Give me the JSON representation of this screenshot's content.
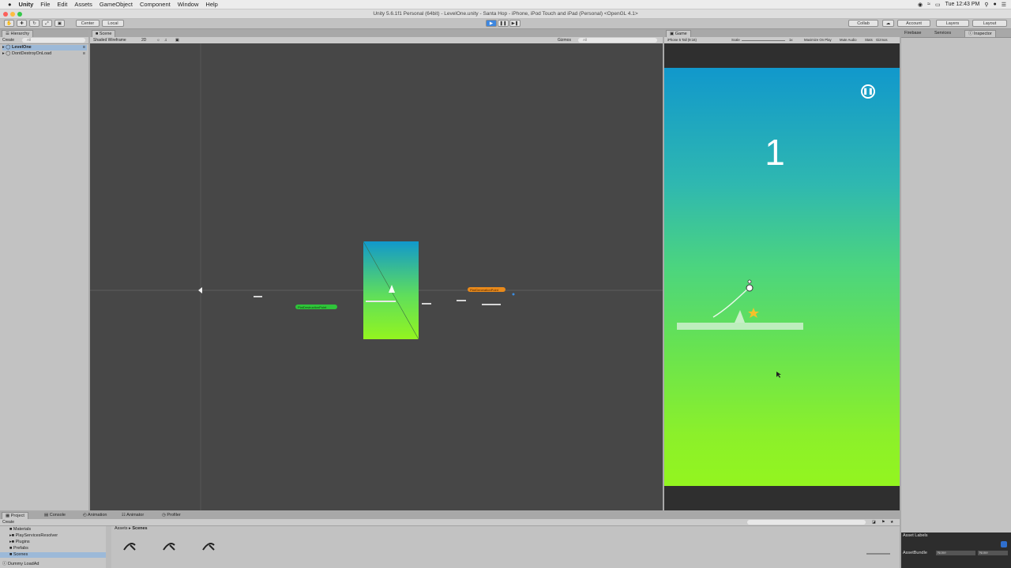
{
  "menubar": {
    "apple": "",
    "items": [
      "Unity",
      "File",
      "Edit",
      "Assets",
      "GameObject",
      "Component",
      "Window",
      "Help"
    ],
    "clock": "Tue 12:43 PM"
  },
  "window": {
    "title": "Unity 5.6.1f1 Personal (64bit) - LevelOne.unity - Santa Hop - iPhone, iPod Touch and iPad (Personal) <OpenGL 4.1>"
  },
  "toolbar": {
    "pivot_center": "Center",
    "pivot_local": "Local",
    "collab": "Collab",
    "account": "Account",
    "layers": "Layers",
    "layout": "Layout"
  },
  "hierarchy": {
    "tab": "Hierarchy",
    "create": "Create",
    "search_placeholder": "All",
    "items": [
      "LevelOne",
      "DontDestroyOnLoad"
    ]
  },
  "scene": {
    "tab": "Scene",
    "shading": "Shaded Wireframe",
    "mode_2d": "2D",
    "gizmos": "Gizmos",
    "search_placeholder": "All",
    "label_green": "PlatDestructionPoint",
    "label_orange": "PlatGenerationPoint"
  },
  "game": {
    "tab": "Game",
    "aspect": "iPhone 5 Tall (9:16)",
    "scale_label": "Scale",
    "scale_value": "1x",
    "maximize": "Maximize On Play",
    "mute": "Mute Audio",
    "stats": "Stats",
    "gizmos": "Gizmos",
    "score": "1",
    "pause_icon": "pause-circle-icon",
    "colors": {
      "top": "#1198cc",
      "bottom": "#93f51f"
    }
  },
  "right_tabs": [
    "Firebase",
    "Services",
    "Inspector"
  ],
  "project": {
    "tabs": [
      "Project",
      "Console",
      "Animation",
      "Animator",
      "Profiler"
    ],
    "create": "Create",
    "folders": [
      "Materials",
      "PlayServicesResolver",
      "Plugins",
      "Prefabs",
      "Scenes"
    ],
    "breadcrumb": [
      "Assets",
      "Scenes"
    ],
    "status": "Dummy LoadAd"
  },
  "asset_labels": {
    "title": "Asset Labels",
    "assetbundle": "AssetBundle",
    "none1": "None",
    "none2": "None"
  }
}
